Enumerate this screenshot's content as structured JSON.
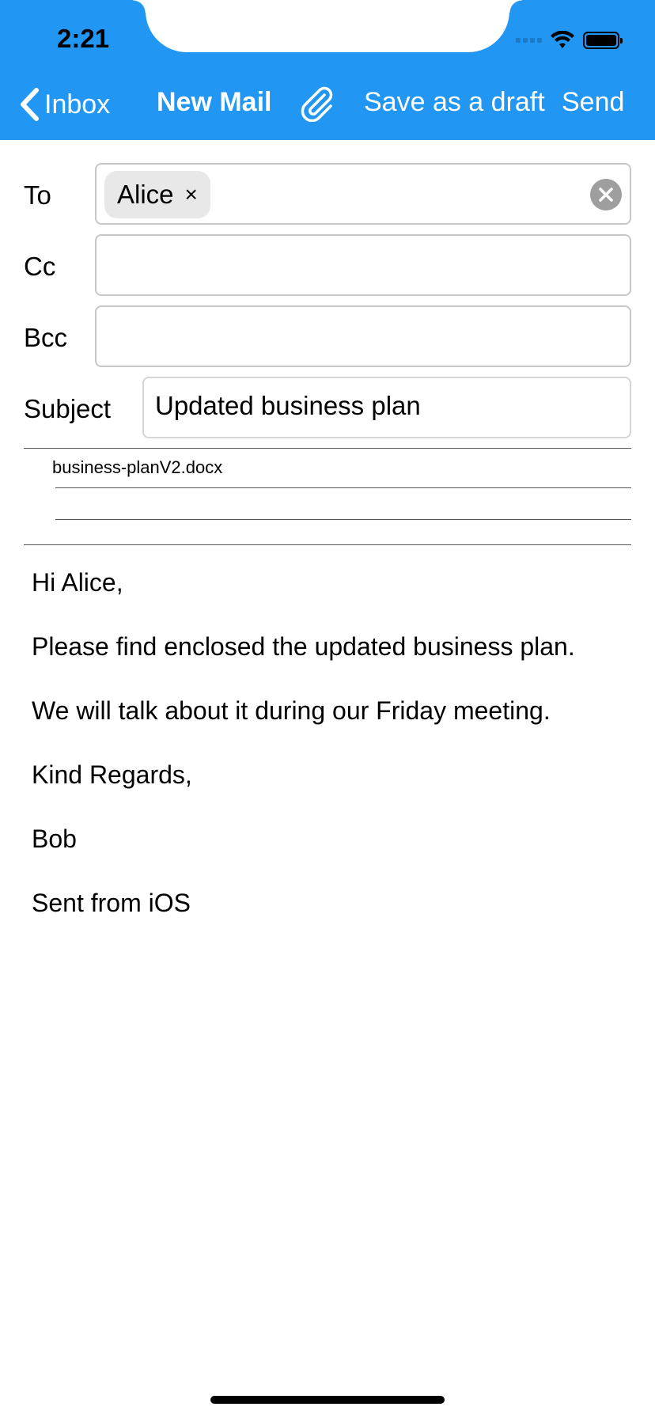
{
  "status_bar": {
    "time": "2:21"
  },
  "nav": {
    "back_label": "Inbox",
    "title": "New Mail",
    "attach_icon": "paperclip-icon",
    "draft_label": "Save as a draft",
    "send_label": "Send"
  },
  "form": {
    "to_label": "To",
    "to_recipients": [
      "Alice"
    ],
    "chip_remove": "×",
    "cc_label": "Cc",
    "cc_value": "",
    "bcc_label": "Bcc",
    "bcc_value": "",
    "subject_label": "Subject",
    "subject_value": "Updated business plan"
  },
  "attachments": [
    "business-planV2.docx"
  ],
  "message_body": [
    "Hi Alice,",
    "Please find enclosed the updated business plan.",
    "We will talk about it during our Friday meeting.",
    "Kind Regards,",
    "Bob",
    "Sent from iOS"
  ],
  "colors": {
    "header": "#2196F3",
    "chip_bg": "#e8e8e8",
    "clear_button": "#9e9e9e"
  }
}
